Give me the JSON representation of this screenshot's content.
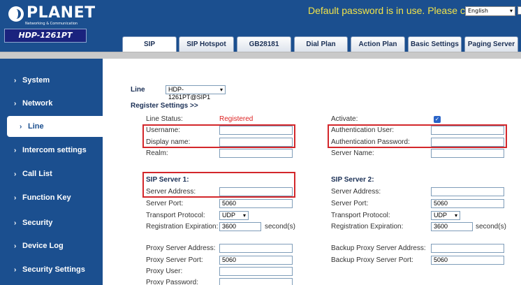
{
  "brand": {
    "logo_text": "PLANET",
    "logo_sub": "Networking & Communication",
    "model": "HDP-1261PT"
  },
  "header": {
    "warning": "Default password is in use. Please change",
    "language": "English"
  },
  "tabs": [
    "SIP",
    "SIP Hotspot",
    "GB28181",
    "Dial Plan",
    "Action Plan",
    "Basic Settings",
    "Paging Server"
  ],
  "active_tab": "SIP",
  "sidebar": {
    "items": [
      "System",
      "Network",
      "Line",
      "Intercom settings",
      "Call List",
      "Function Key",
      "Security",
      "Device Log",
      "Security Settings"
    ],
    "active": "Line"
  },
  "line": {
    "label": "Line",
    "value": "HDP-1261PT@SIP1"
  },
  "register": {
    "title": "Register Settings >>",
    "line_status_label": "Line Status:",
    "line_status_value": "Registered",
    "activate_label": "Activate:",
    "activate_checked": true,
    "username_label": "Username:",
    "auth_user_label": "Authentication User:",
    "display_name_label": "Display name:",
    "auth_password_label": "Authentication Password:",
    "realm_label": "Realm:",
    "server_name_label": "Server Name:"
  },
  "sip1": {
    "title": "SIP Server 1:",
    "address_label": "Server Address:",
    "port_label": "Server Port:",
    "port_value": "5060",
    "transport_label": "Transport Protocol:",
    "transport_value": "UDP",
    "expiration_label": "Registration Expiration:",
    "expiration_value": "3600",
    "unit": "second(s)"
  },
  "sip2": {
    "title": "SIP Server 2:",
    "address_label": "Server Address:",
    "port_label": "Server Port:",
    "port_value": "5060",
    "transport_label": "Transport Protocol:",
    "transport_value": "UDP",
    "expiration_label": "Registration Expiration:",
    "expiration_value": "3600",
    "unit": "second(s)"
  },
  "proxy": {
    "address_label": "Proxy Server Address:",
    "port_label": "Proxy Server Port:",
    "port_value": "5060",
    "user_label": "Proxy User:",
    "password_label": "Proxy Password:",
    "backup_address_label": "Backup Proxy Server Address:",
    "backup_port_label": "Backup Proxy Server Port:",
    "backup_port_value": "5060"
  },
  "colors": {
    "brand_blue": "#1b4f8f",
    "warning_yellow": "#f1e34a",
    "highlight_red": "#d3272b",
    "status_red": "#d22222"
  }
}
